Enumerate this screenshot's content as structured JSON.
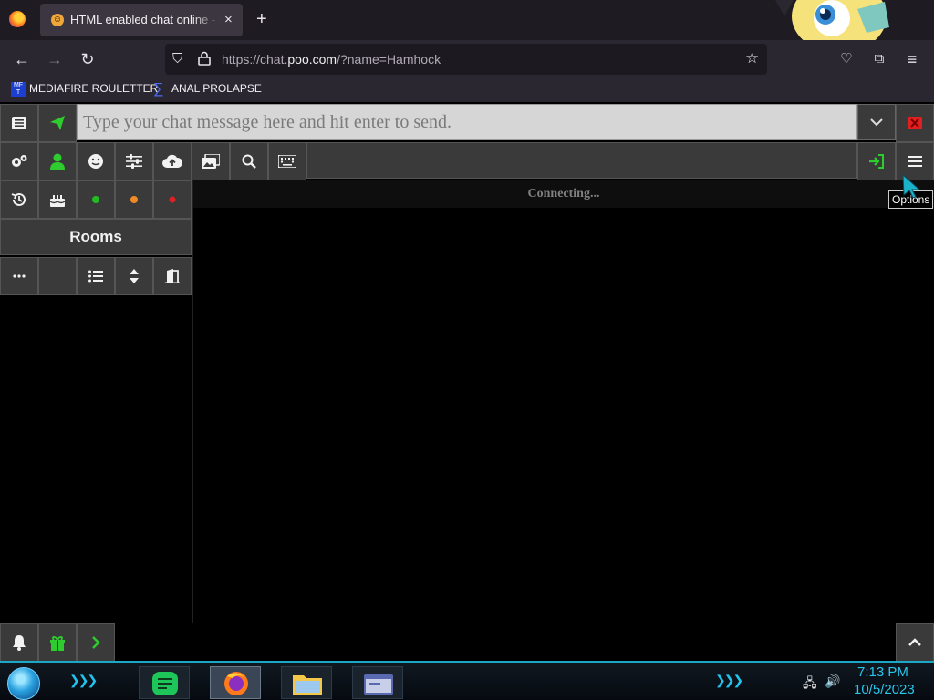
{
  "browser": {
    "tab": {
      "title": "HTML enabled chat online - Fre",
      "favicon": "grinning-face-icon",
      "close": "×"
    },
    "new_tab": "+",
    "url": {
      "prefix": "https://chat.",
      "domain": "poo.com",
      "path": "/?name=Hamhock"
    },
    "bookmarks": [
      {
        "icon": "mediafire-icon",
        "label": "MEDIAFIRE ROULETTER"
      },
      {
        "icon": "sigma-icon",
        "label": "ANAL PROLAPSE"
      }
    ]
  },
  "chat": {
    "input": {
      "placeholder": "Type your chat message here and hit enter to send."
    },
    "status": "Connecting...",
    "rooms_label": "Rooms",
    "tooltip": "Options",
    "accent_green": "#2ecc2e",
    "accent_red": "#e02020",
    "status_dots": [
      "#22bb22",
      "#f08a24",
      "#dd2222"
    ]
  },
  "taskbar": {
    "time": "7:13 PM",
    "date": "10/5/2023",
    "accent": "#27c6ea"
  }
}
